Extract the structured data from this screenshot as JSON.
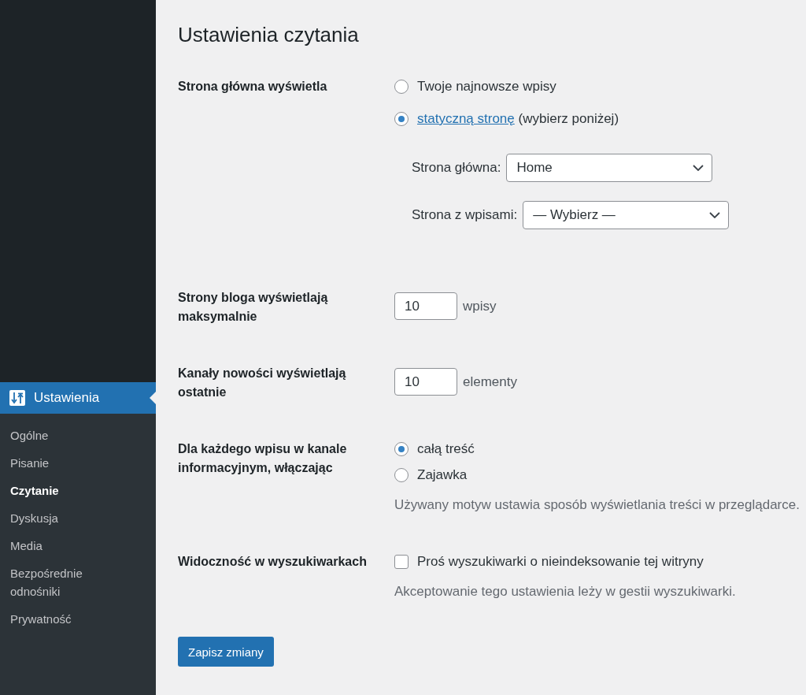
{
  "sidebar": {
    "menu": [
      {
        "label": "Ustawienia",
        "selected": true,
        "submenu": [
          {
            "label": "Ogólne",
            "selected": false
          },
          {
            "label": "Pisanie",
            "selected": false
          },
          {
            "label": "Czytanie",
            "selected": true
          },
          {
            "label": "Dyskusja",
            "selected": false
          },
          {
            "label": "Media",
            "selected": false
          },
          {
            "label": "Bezpośrednie odnośniki",
            "selected": false
          },
          {
            "label": "Prywatność",
            "selected": false
          }
        ]
      }
    ]
  },
  "page": {
    "title": "Ustawienia czytania"
  },
  "settings": [
    {
      "kind": "radio_group",
      "label": "Strona główna wyświetla",
      "options": [
        {
          "label": "Twoje najnowsze wpisy",
          "selected": false
        },
        {
          "link": "statyczną stronę",
          "label": "(wybierz poniżej)",
          "selected": true
        }
      ],
      "subfields": [
        {
          "label": "Strona główna:",
          "value": "Home"
        },
        {
          "label": "Strona z wpisami:",
          "value": "— Wybierz —"
        }
      ]
    },
    {
      "kind": "number",
      "label": "Strony bloga wyświetlają maksymalnie",
      "value": "10",
      "unit": "wpisy"
    },
    {
      "kind": "number",
      "label": "Kanały nowości wyświetlają ostatnie",
      "value": "10",
      "unit": "elementy"
    },
    {
      "kind": "radio_group",
      "label": "Dla każdego wpisu w kanale informacyjnym, włączając",
      "options": [
        {
          "label": "całą treść",
          "selected": true
        },
        {
          "label": "Zajawka",
          "selected": false
        }
      ],
      "description": "Używany motyw ustawia sposób wyświetlania treści w przeglądarce."
    },
    {
      "kind": "checkbox",
      "label": "Widoczność w wyszukiwarkach",
      "option": "Proś wyszukiwarki o nieindeksowanie tej witryny",
      "checked": false,
      "description": "Akceptowanie tego ustawienia leży w gestii wyszukiwarki."
    }
  ],
  "save_button": {
    "label": "Zapisz zmiany"
  }
}
